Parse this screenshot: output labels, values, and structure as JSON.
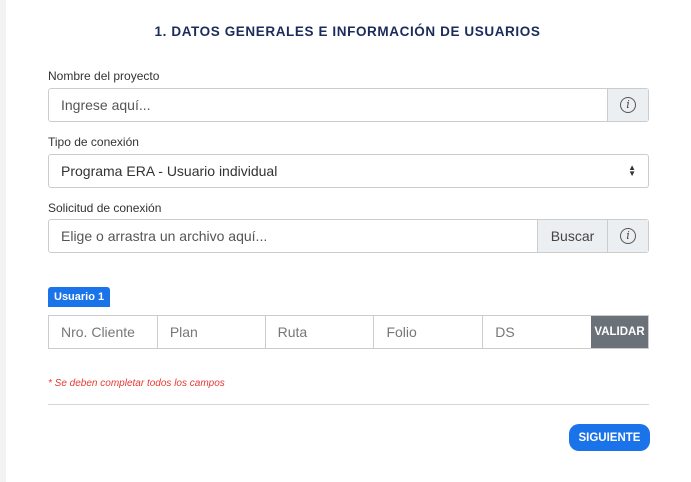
{
  "section": {
    "title": "1. DATOS GENERALES E INFORMACIÓN DE USUARIOS"
  },
  "project": {
    "label": "Nombre del proyecto",
    "placeholder": "Ingrese aquí..."
  },
  "connection_type": {
    "label": "Tipo de conexión",
    "selected": "Programa ERA - Usuario individual"
  },
  "request": {
    "label": "Solicitud de conexión",
    "placeholder": "Elige o arrastra un archivo aquí...",
    "browse_label": "Buscar"
  },
  "user": {
    "badge": "Usuario 1",
    "fields": [
      "Nro. Cliente",
      "Plan",
      "Ruta",
      "Folio",
      "DS"
    ],
    "validate_label": "VALIDAR"
  },
  "note": "* Se deben completar todos los campos",
  "next_label": "SIGUIENTE",
  "colors": {
    "primary": "#1a73e8",
    "title": "#1b2c5b",
    "error": "#e53935",
    "validate_bg": "#6a7178"
  }
}
